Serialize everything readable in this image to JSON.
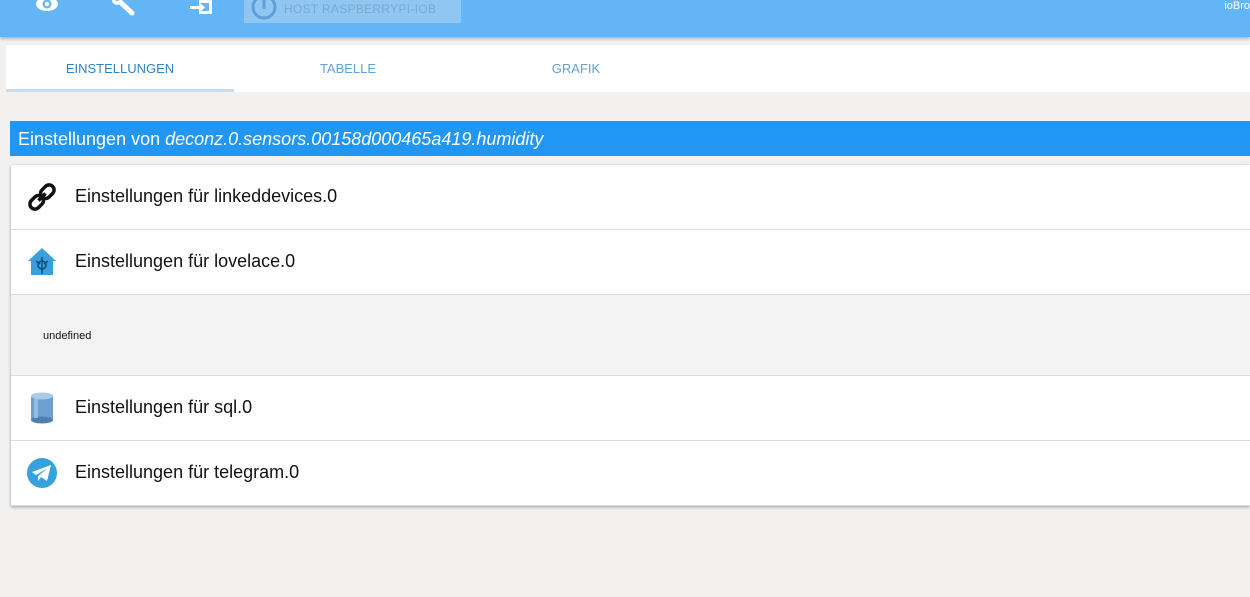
{
  "toolbar": {
    "icons": [
      "eye-icon",
      "wrench-icon",
      "logout-icon"
    ],
    "host_label": "HOST RASPBERRYPI-IOB",
    "brand": "ioBro"
  },
  "tabs": [
    {
      "label": "EINSTELLUNGEN",
      "active": true
    },
    {
      "label": "TABELLE",
      "active": false
    },
    {
      "label": "GRAFIK",
      "active": false
    }
  ],
  "header": {
    "prefix": "Einstellungen von ",
    "object_id": "deconz.0.sensors.00158d000465a419.humidity"
  },
  "adapters": [
    {
      "label": "Einstellungen für linkeddevices.0",
      "icon": "chain-link-icon"
    },
    {
      "label": "Einstellungen für lovelace.0",
      "icon": "home-assistant-icon"
    },
    {
      "text": "undefined"
    },
    {
      "label": "Einstellungen für sql.0",
      "icon": "database-icon"
    },
    {
      "label": "Einstellungen für telegram.0",
      "icon": "telegram-icon"
    }
  ],
  "colors": {
    "toolbar": "#64b5f6",
    "header": "#2196f3",
    "tab_text": "#5fa2dd",
    "background": "#f3f1ef"
  }
}
